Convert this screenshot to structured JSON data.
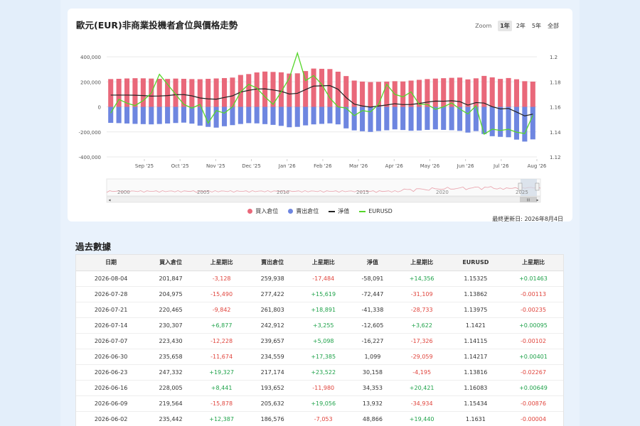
{
  "title": "歐元(EUR)非商業投機者倉位與價格走勢",
  "zoom": {
    "label": "Zoom",
    "options": [
      "1年",
      "2年",
      "5年",
      "全部"
    ],
    "active": "1年"
  },
  "legend": [
    "買入倉位",
    "賣出倉位",
    "淨值",
    "EURUSD"
  ],
  "last_updated": "最終更新日: 2026年8月4日",
  "table_title": "過去數據",
  "colors": {
    "long": "#e9687a",
    "short": "#6e86e0",
    "net": "#222222",
    "eurusd": "#55d62a"
  },
  "navigator": {
    "year_labels": [
      "2000",
      "2005",
      "2010",
      "2015",
      "2020",
      "2025"
    ],
    "scroll_label": "III"
  },
  "chart_data": {
    "type": "bar",
    "y_left": {
      "min": -400000,
      "max": 400000,
      "ticks": [
        400000,
        200000,
        0,
        -200000,
        -400000
      ],
      "tick_labels": [
        "400,000",
        "200,000",
        "0",
        "-200,000",
        "-400,000"
      ]
    },
    "y_right": {
      "min": 1.12,
      "max": 1.2,
      "ticks": [
        1.2,
        1.18,
        1.16,
        1.14,
        1.12
      ],
      "tick_labels": [
        "1.2",
        "1.18",
        "1.16",
        "1.14",
        "1.12"
      ]
    },
    "x_labels": [
      "Sep '25",
      "Oct '25",
      "Nov '25",
      "Dec '25",
      "Jan '26",
      "Feb '26",
      "Mar '26",
      "Apr '26",
      "May '26",
      "Jun '26",
      "Jul '26",
      "Aug '26"
    ],
    "series": [
      {
        "name": "買入倉位",
        "values": [
          222000,
          224000,
          227000,
          229000,
          228000,
          226000,
          224000,
          223000,
          226000,
          224000,
          222000,
          221000,
          224000,
          227000,
          230000,
          234000,
          255000,
          262000,
          275000,
          282000,
          279000,
          276000,
          266000,
          268000,
          286000,
          306000,
          304000,
          302000,
          281000,
          246000,
          210000,
          202000,
          198000,
          200000,
          202000,
          205000,
          203000,
          210000,
          216000,
          222000,
          226000,
          229000,
          232000,
          234000,
          219564,
          228005,
          247332,
          235658,
          223430,
          230307,
          220465,
          204975,
          201847
        ]
      },
      {
        "name": "賣出倉位",
        "values": [
          -128000,
          -130000,
          -133000,
          -136000,
          -138000,
          -140000,
          -137000,
          -133000,
          -129000,
          -126000,
          -134000,
          -150000,
          -160000,
          -166000,
          -155000,
          -146000,
          -137000,
          -130000,
          -132000,
          -138000,
          -144000,
          -152000,
          -163000,
          -160000,
          -148000,
          -140000,
          -136000,
          -132000,
          -140000,
          -172000,
          -188000,
          -195000,
          -200000,
          -193000,
          -187000,
          -180000,
          -185000,
          -191000,
          -189000,
          -184000,
          -180000,
          -184000,
          -186576,
          -192000,
          -205632,
          -193652,
          -217174,
          -234559,
          -239657,
          -242912,
          -261803,
          -277422,
          -259938
        ]
      },
      {
        "name": "淨值",
        "values": [
          94000,
          94000,
          94000,
          93000,
          90000,
          86000,
          87000,
          90000,
          97000,
          98000,
          88000,
          71000,
          64000,
          61000,
          75000,
          88000,
          118000,
          132000,
          143000,
          144000,
          135000,
          124000,
          103000,
          108000,
          138000,
          166000,
          168000,
          170000,
          141000,
          74000,
          22000,
          7000,
          -2000,
          7000,
          15000,
          25000,
          18000,
          19000,
          27000,
          38000,
          46000,
          45000,
          48866,
          42000,
          13932,
          34353,
          30158,
          1099,
          -16227,
          -12605,
          -41338,
          -72447,
          -58091
        ]
      },
      {
        "name": "EURUSD",
        "values": [
          1.155,
          1.166,
          1.163,
          1.161,
          1.165,
          1.171,
          1.186,
          1.178,
          1.17,
          1.162,
          1.159,
          1.162,
          1.147,
          1.157,
          1.155,
          1.16,
          1.172,
          1.178,
          1.175,
          1.168,
          1.162,
          1.172,
          1.183,
          1.203,
          1.181,
          1.185,
          1.178,
          1.167,
          1.16,
          1.159,
          1.153,
          1.157,
          1.156,
          1.162,
          1.178,
          1.17,
          1.168,
          1.172,
          1.162,
          1.162,
          1.158,
          1.16,
          1.1631,
          1.1583,
          1.15434,
          1.16083,
          1.13816,
          1.14217,
          1.14115,
          1.1421,
          1.13975,
          1.13862,
          1.15325
        ]
      }
    ]
  },
  "table": {
    "headers": [
      "日期",
      "買入倉位",
      "上星期比",
      "賣出倉位",
      "上星期比",
      "淨值",
      "上星期比",
      "EURUSD",
      "上星期比"
    ],
    "rows": [
      [
        "2026-08-04",
        "201,847",
        "-3,128",
        "259,938",
        "-17,484",
        "-58,091",
        "+14,356",
        "1.15325",
        "+0.01463"
      ],
      [
        "2026-07-28",
        "204,975",
        "-15,490",
        "277,422",
        "+15,619",
        "-72,447",
        "-31,109",
        "1.13862",
        "-0.00113"
      ],
      [
        "2026-07-21",
        "220,465",
        "-9,842",
        "261,803",
        "+18,891",
        "-41,338",
        "-28,733",
        "1.13975",
        "-0.00235"
      ],
      [
        "2026-07-14",
        "230,307",
        "+6,877",
        "242,912",
        "+3,255",
        "-12,605",
        "+3,622",
        "1.1421",
        "+0.00095"
      ],
      [
        "2026-07-07",
        "223,430",
        "-12,228",
        "239,657",
        "+5,098",
        "-16,227",
        "-17,326",
        "1.14115",
        "-0.00102"
      ],
      [
        "2026-06-30",
        "235,658",
        "-11,674",
        "234,559",
        "+17,385",
        "1,099",
        "-29,059",
        "1.14217",
        "+0.00401"
      ],
      [
        "2026-06-23",
        "247,332",
        "+19,327",
        "217,174",
        "+23,522",
        "30,158",
        "-4,195",
        "1.13816",
        "-0.02267"
      ],
      [
        "2026-06-16",
        "228,005",
        "+8,441",
        "193,652",
        "-11,980",
        "34,353",
        "+20,421",
        "1.16083",
        "+0.00649"
      ],
      [
        "2026-06-09",
        "219,564",
        "-15,878",
        "205,632",
        "+19,056",
        "13,932",
        "-34,934",
        "1.15434",
        "-0.00876"
      ],
      [
        "2026-06-02",
        "235,442",
        "+12,387",
        "186,576",
        "-7,053",
        "48,866",
        "+19,440",
        "1.1631",
        "-0.00004"
      ]
    ]
  }
}
